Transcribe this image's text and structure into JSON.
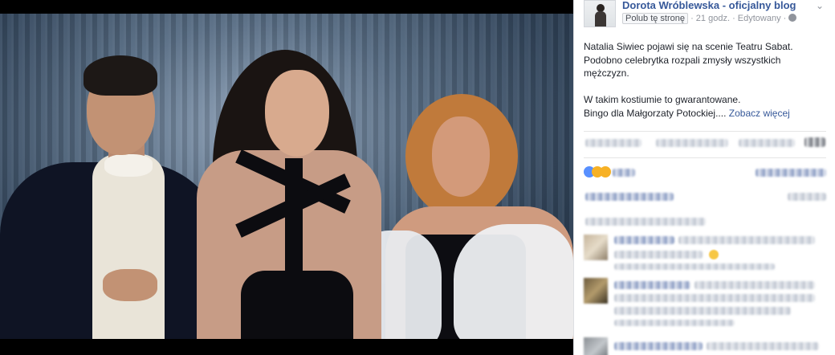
{
  "post": {
    "page_name": "Dorota Wróblewska - oficjalny blog",
    "like_page_label": "Polub tę stronę",
    "time": "21 godz.",
    "separator": "·",
    "edited_label": "Edytowany",
    "text_lines": [
      "Natalia Siwiec pojawi się na scenie Teatru Sabat.",
      "Podobno celebrytka rozpali zmysły wszystkich",
      "mężczyzn.",
      "",
      "W takim kostiumie to gwarantowane.",
      "Bingo dla Małgorzaty Potockiej...."
    ],
    "see_more_label": "Zobacz więcej"
  },
  "icons": {
    "options": "chevron-down-icon",
    "privacy": "globe-icon",
    "reactions": [
      "like-icon",
      "haha-icon",
      "wow-icon"
    ]
  },
  "colors": {
    "link_blue": "#365899",
    "meta_gray": "#90949c",
    "text": "#1d2129"
  }
}
